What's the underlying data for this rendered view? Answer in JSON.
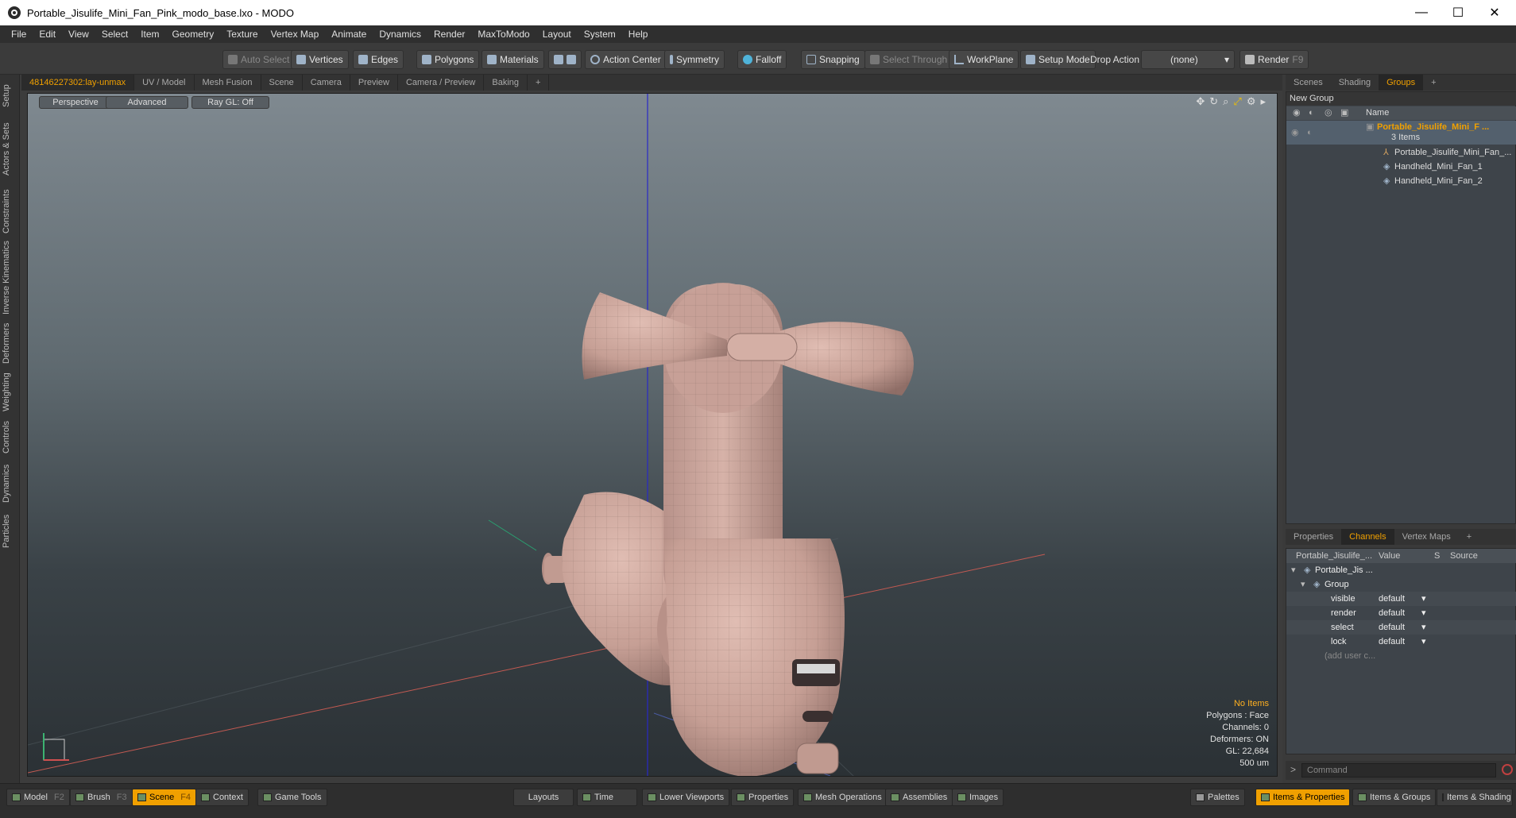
{
  "window": {
    "title": "Portable_Jisulife_Mini_Fan_Pink_modo_base.lxo - MODO",
    "minimize": "—",
    "maximize": "☐",
    "close": "✕"
  },
  "menu": [
    "File",
    "Edit",
    "View",
    "Select",
    "Item",
    "Geometry",
    "Texture",
    "Vertex Map",
    "Animate",
    "Dynamics",
    "Render",
    "MaxToModo",
    "Layout",
    "System",
    "Help"
  ],
  "toolbar": {
    "auto_select": "Auto Select",
    "vertices": "Vertices",
    "edges": "Edges",
    "polygons": "Polygons",
    "materials": "Materials",
    "action_center": "Action Center",
    "symmetry": "Symmetry",
    "falloff": "Falloff",
    "snapping": "Snapping",
    "select_through": "Select Through",
    "workplane": "WorkPlane",
    "setup_mode": "Setup Mode",
    "drop_action": "Drop Action",
    "drop_value": "(none)",
    "render": "Render",
    "render_key": "F9"
  },
  "sidebar_tabs": [
    "Setup",
    "Actors & Sets",
    "Constraints",
    "Inverse Kinematics",
    "Deformers",
    "Weighting",
    "Controls",
    "Dynamics",
    "Particles"
  ],
  "viewport_tabs": [
    "48146227302:lay-unmax",
    "UV / Model",
    "Mesh Fusion",
    "Scene",
    "Camera",
    "Preview",
    "Camera / Preview",
    "Baking",
    "+"
  ],
  "viewport": {
    "perspective": "Perspective",
    "advanced": "Advanced",
    "raygl": "Ray GL: Off",
    "info": {
      "items": "No Items",
      "polygons": "Polygons : Face",
      "channels": "Channels: 0",
      "deformers": "Deformers: ON",
      "gl": "GL: 22,684",
      "scale": "500 um"
    }
  },
  "groups_tabs": [
    "Scenes",
    "Shading",
    "Groups",
    "+"
  ],
  "groups": {
    "new_group": "New Group",
    "name_header": "Name",
    "root": "Portable_Jisulife_Mini_F ...",
    "count": "3 Items",
    "children": [
      "Portable_Jisulife_Mini_Fan_...",
      "Handheld_Mini_Fan_1",
      "Handheld_Mini_Fan_2"
    ]
  },
  "props_tabs": [
    "Properties",
    "Channels",
    "Vertex Maps",
    "+"
  ],
  "channels": {
    "col_name": "Portable_Jisulife_...",
    "col_value": "Value",
    "col_s": "S",
    "col_source": "Source",
    "item": "Portable_Jis ...",
    "group": "Group",
    "rows": [
      {
        "name": "visible",
        "value": "default"
      },
      {
        "name": "render",
        "value": "default"
      },
      {
        "name": "select",
        "value": "default"
      },
      {
        "name": "lock",
        "value": "default"
      }
    ],
    "add_user": "(add user c..."
  },
  "command": {
    "prompt": ">",
    "placeholder": "Command"
  },
  "bottom": {
    "model": "Model",
    "model_key": "F2",
    "brush": "Brush",
    "brush_key": "F3",
    "scene": "Scene",
    "scene_key": "F4",
    "context": "Context",
    "game_tools": "Game Tools",
    "layouts": "Layouts",
    "time": "Time",
    "lower_viewports": "Lower Viewports",
    "properties": "Properties",
    "mesh_operations": "Mesh Operations",
    "assemblies": "Assemblies",
    "images": "Images",
    "palettes": "Palettes",
    "items_properties": "Items & Properties",
    "items_groups": "Items & Groups",
    "items_shading": "Items & Shading"
  },
  "colors": {
    "accent": "#f0a000",
    "mesh": "#caa49a",
    "panel": "#3a3a3a"
  }
}
